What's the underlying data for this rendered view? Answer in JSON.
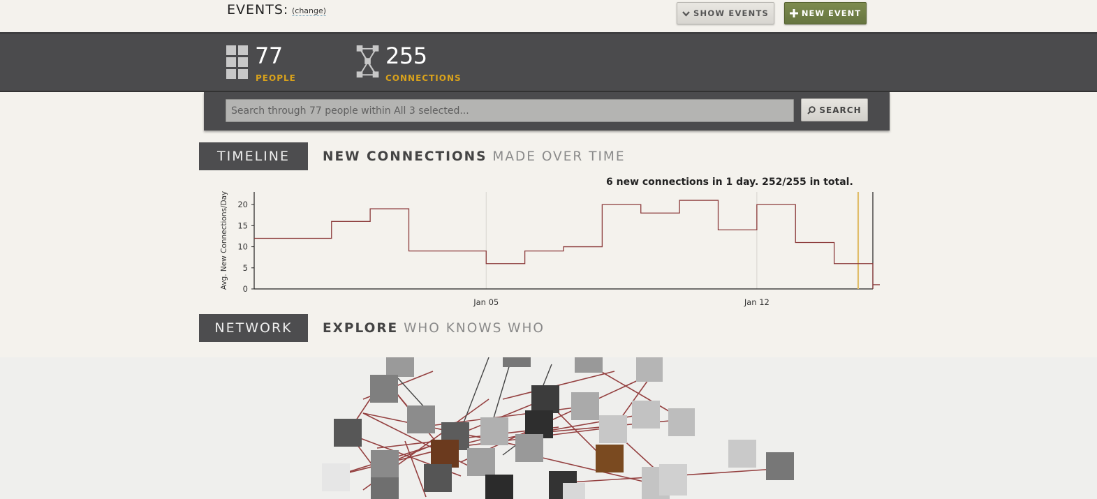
{
  "header": {
    "events_title": "EVENTS:",
    "change_link": "(change)",
    "show_events_label": "SHOW EVENTS",
    "new_event_label": "NEW EVENT"
  },
  "stats": {
    "people_count": "77",
    "people_label": "PEOPLE",
    "connections_count": "255",
    "connections_label": "CONNECTIONS",
    "label_color": "#d9a21b"
  },
  "search": {
    "placeholder": "Search through 77 people within All 3 selected...",
    "button_label": "SEARCH"
  },
  "timeline": {
    "tab_label": "TIMELINE",
    "title_strong": "NEW CONNECTIONS",
    "title_light": "MADE OVER TIME",
    "status_text": "6 new connections in 1 day. 252/255 in total."
  },
  "network": {
    "tab_label": "NETWORK",
    "title_strong": "EXPLORE",
    "title_light": "WHO KNOWS WHO"
  },
  "chart_data": {
    "type": "line",
    "ylabel": "Avg. New Connections/Day",
    "xlabel": "",
    "ylim": [
      0,
      23
    ],
    "yticks": [
      0,
      5,
      10,
      15,
      20
    ],
    "xticks": [
      "Jan 05",
      "Jan 12"
    ],
    "series": [
      {
        "step": true,
        "points": [
          [
            "Dec 30",
            12
          ],
          [
            "Jan 01",
            16
          ],
          [
            "Jan 02",
            19
          ],
          [
            "Jan 03",
            9
          ],
          [
            "Jan 05",
            6
          ],
          [
            "Jan 06",
            9
          ],
          [
            "Jan 07",
            10
          ],
          [
            "Jan 08",
            20
          ],
          [
            "Jan 09",
            18
          ],
          [
            "Jan 10",
            21
          ],
          [
            "Jan 11",
            14
          ],
          [
            "Jan 12",
            20
          ],
          [
            "Jan 13",
            11
          ],
          [
            "Jan 14",
            6
          ],
          [
            "Jan 15",
            1
          ],
          [
            "Jan 16",
            1
          ]
        ],
        "color": "#8b3a3a"
      }
    ],
    "highlight_date": "Jan 14",
    "highlight_color": "#e0bd6a"
  }
}
